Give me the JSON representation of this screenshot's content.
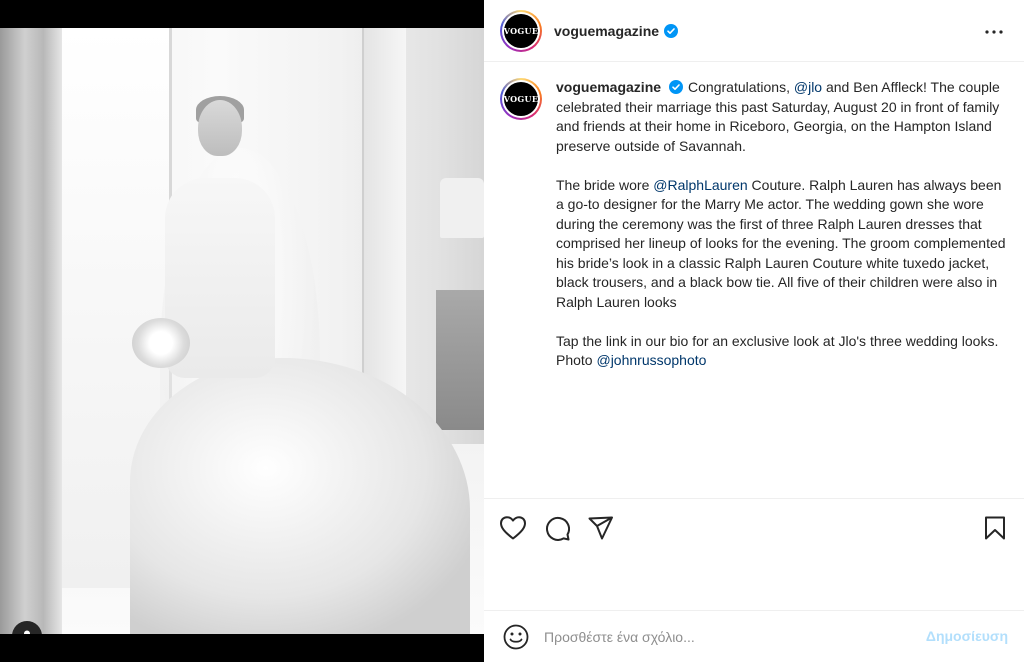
{
  "post": {
    "username": "voguemagazine",
    "avatar_text": "VOGUE",
    "verified_icon": "verified-badge-icon",
    "more_icon": "more-options-icon"
  },
  "caption": {
    "username": "voguemagazine",
    "p1_a": "Congratulations, ",
    "p1_mention": "@jlo",
    "p1_b": " and Ben Affleck! The couple celebrated their marriage this past Saturday, August 20 in front of family and friends at their home in Riceboro, Georgia, on the Hampton Island preserve outside of Savannah.",
    "p2_a": "The bride wore ",
    "p2_mention": "@RalphLauren",
    "p2_b": " Couture. Ralph Lauren has always been a go-to designer for the Marry Me actor. The wedding gown she wore during the ceremony was the first of three Ralph Lauren dresses that comprised her lineup of looks for the evening. The groom complemented his bride’s look in a classic Ralph Lauren Couture white tuxedo jacket, black trousers, and a black bow tie. All five of their children were also in Ralph Lauren looks",
    "p3": "Tap the link in our bio for an exclusive look at Jlo's three wedding looks.",
    "p4_a": "Photo ",
    "p4_mention": "@johnrussophoto"
  },
  "actions": {
    "like_icon": "heart-icon",
    "comment_icon": "comment-icon",
    "share_icon": "send-icon",
    "save_icon": "bookmark-icon"
  },
  "comment": {
    "placeholder": "Προσθέστε ένα σχόλιο...",
    "post_label": "Δημοσίευση",
    "emoji_icon": "emoji-icon"
  },
  "media": {
    "user_tag_icon": "user-tag-icon"
  },
  "colors": {
    "link": "#00376b",
    "text": "#262626",
    "muted": "#8e8e8e",
    "post_disabled": "#b2dffc",
    "verified": "#0095f6"
  }
}
